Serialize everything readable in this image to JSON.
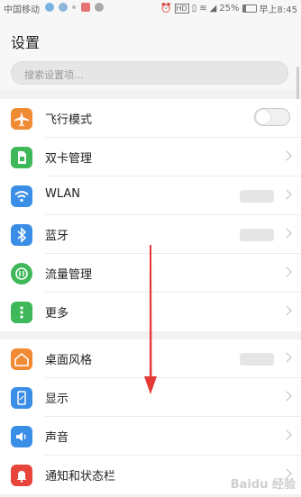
{
  "statusbar": {
    "carrier": "中国移动",
    "battery": "25%",
    "time": "早上8:45"
  },
  "header": {
    "title": "设置",
    "search_placeholder": "搜索设置项..."
  },
  "groups": [
    {
      "items": [
        {
          "label": "飞行模式",
          "icon": "airplane-icon",
          "color": "#f08a33",
          "control": "toggle",
          "toggle_on": false
        },
        {
          "label": "双卡管理",
          "icon": "sim-card-icon",
          "color": "#3fb85a",
          "control": "chevron"
        },
        {
          "label": "WLAN",
          "icon": "wifi-icon",
          "color": "#3a8ee6",
          "control": "chevron"
        },
        {
          "label": "蓝牙",
          "icon": "bluetooth-icon",
          "color": "#3a8ee6",
          "control": "chevron"
        },
        {
          "label": "流量管理",
          "icon": "data-usage-icon",
          "color": "#3fb85a",
          "control": "chevron"
        },
        {
          "label": "更多",
          "icon": "more-icon",
          "color": "#3fb85a",
          "control": "chevron"
        }
      ]
    },
    {
      "items": [
        {
          "label": "桌面风格",
          "icon": "home-style-icon",
          "color": "#f08a33",
          "control": "chevron"
        },
        {
          "label": "显示",
          "icon": "display-icon",
          "color": "#3a8ee6",
          "control": "chevron"
        },
        {
          "label": "声音",
          "icon": "sound-icon",
          "color": "#3a8ee6",
          "control": "chevron"
        },
        {
          "label": "通知和状态栏",
          "icon": "notification-bell-icon",
          "color": "#e8453c",
          "control": "chevron"
        }
      ]
    }
  ],
  "annotation": {
    "arrow_color": "#e53935"
  },
  "watermark": "Baidu 经验"
}
